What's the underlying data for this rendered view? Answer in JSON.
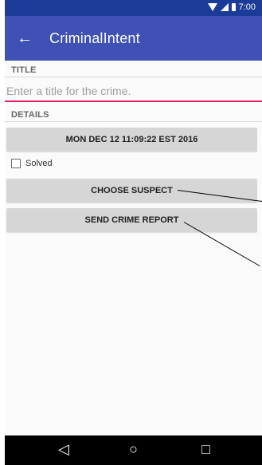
{
  "status": {
    "time": "7:00"
  },
  "toolbar": {
    "title": "CriminalIntent"
  },
  "sections": {
    "title": "TITLE",
    "details": "DETAILS"
  },
  "crime_title": {
    "placeholder": "Enter a title for the crime."
  },
  "date_button": {
    "label": "MON DEC 12 11:09:22 EST 2016"
  },
  "solved": {
    "label": "Solved",
    "checked": false
  },
  "suspect_button": {
    "label": "CHOOSE SUSPECT"
  },
  "report_button": {
    "label": "SEND CRIME REPORT"
  },
  "icons": {
    "back": "back-arrow-icon",
    "wifi": "wifi-icon",
    "signal": "signal-icon",
    "battery": "battery-icon",
    "nav_back": "nav-back-icon",
    "nav_home": "nav-home-icon",
    "nav_recents": "nav-recents-icon"
  },
  "colors": {
    "status_bar": "#1a3b97",
    "toolbar": "#3f51b5",
    "accent": "#e91e63",
    "button": "#d6d6d6"
  }
}
